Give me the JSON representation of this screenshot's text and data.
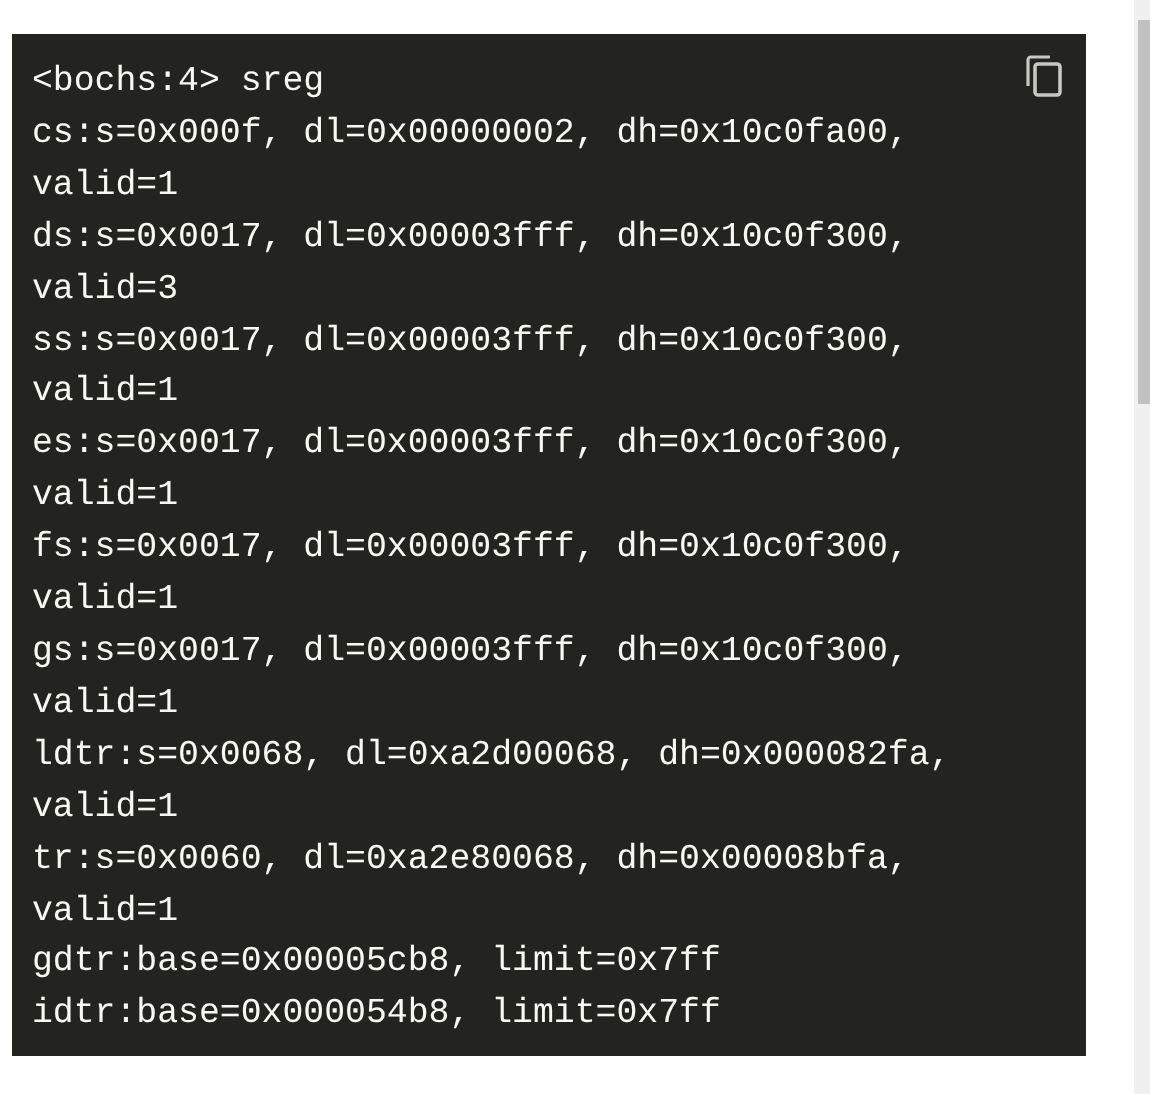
{
  "code_block": {
    "lines": [
      "<bochs:4> sreg",
      "cs:s=0x000f, dl=0x00000002, dh=0x10c0fa00,",
      "valid=1",
      "ds:s=0x0017, dl=0x00003fff, dh=0x10c0f300,",
      "valid=3",
      "ss:s=0x0017, dl=0x00003fff, dh=0x10c0f300,",
      "valid=1",
      "es:s=0x0017, dl=0x00003fff, dh=0x10c0f300,",
      "valid=1",
      "fs:s=0x0017, dl=0x00003fff, dh=0x10c0f300,",
      "valid=1",
      "gs:s=0x0017, dl=0x00003fff, dh=0x10c0f300,",
      "valid=1",
      "ldtr:s=0x0068, dl=0xa2d00068, dh=0x000082fa,",
      "valid=1",
      "tr:s=0x0060, dl=0xa2e80068, dh=0x00008bfa,",
      "valid=1",
      "gdtr:base=0x00005cb8, limit=0x7ff",
      "idtr:base=0x000054b8, limit=0x7ff"
    ]
  }
}
